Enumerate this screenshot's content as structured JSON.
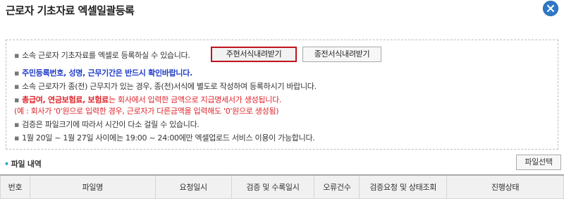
{
  "title": "근로자 기초자료 엑셀일괄등록",
  "notice": {
    "line1": "소속 근로자 기초자료를 엑셀로 등록하실 수 있습니다.",
    "line2": "주민등록번호, 성명, 근무기간은 반드시 확인바랍니다.",
    "line3": "소속 근로자가 종(전) 근무지가 있는 경우, 종(전)서식에 별도로 작성하여 등록하시기 바랍니다.",
    "line4_bold": "총급여, 연금보험료, 보험료",
    "line4_rest": "는 회사에서 입력한 금액으로 지급명세서가 생성됩니다.",
    "line5": "(예 : 회사가 '0'원으로 입력한 경우, 근로자가 다른금액을 입력해도 '0'원으로 생성됨)",
    "line6": "검증은 파일크기에 따라서 시간이 다소 걸릴 수 있습니다.",
    "line7": "1월 20일 ~ 1월 27일 사이에는 19:00 ~ 24:00에만 엑셀업로드 서비스 이용이 가능합니다."
  },
  "buttons": {
    "current_form": "주현서식내려받기",
    "previous_form": "종전서식내려받기",
    "file_select": "파일선택"
  },
  "section_title": "파일 내역",
  "table": {
    "headers": [
      "번호",
      "파일명",
      "요청일시",
      "검증 및 수록일시",
      "오류건수",
      "검증요청 및 상태조회",
      "진행상태"
    ]
  },
  "colors": {
    "close_button": "#2f78c7",
    "highlight_border": "#c0141c",
    "blue_text": "#1f3cc7",
    "red_text": "#e0242a"
  }
}
